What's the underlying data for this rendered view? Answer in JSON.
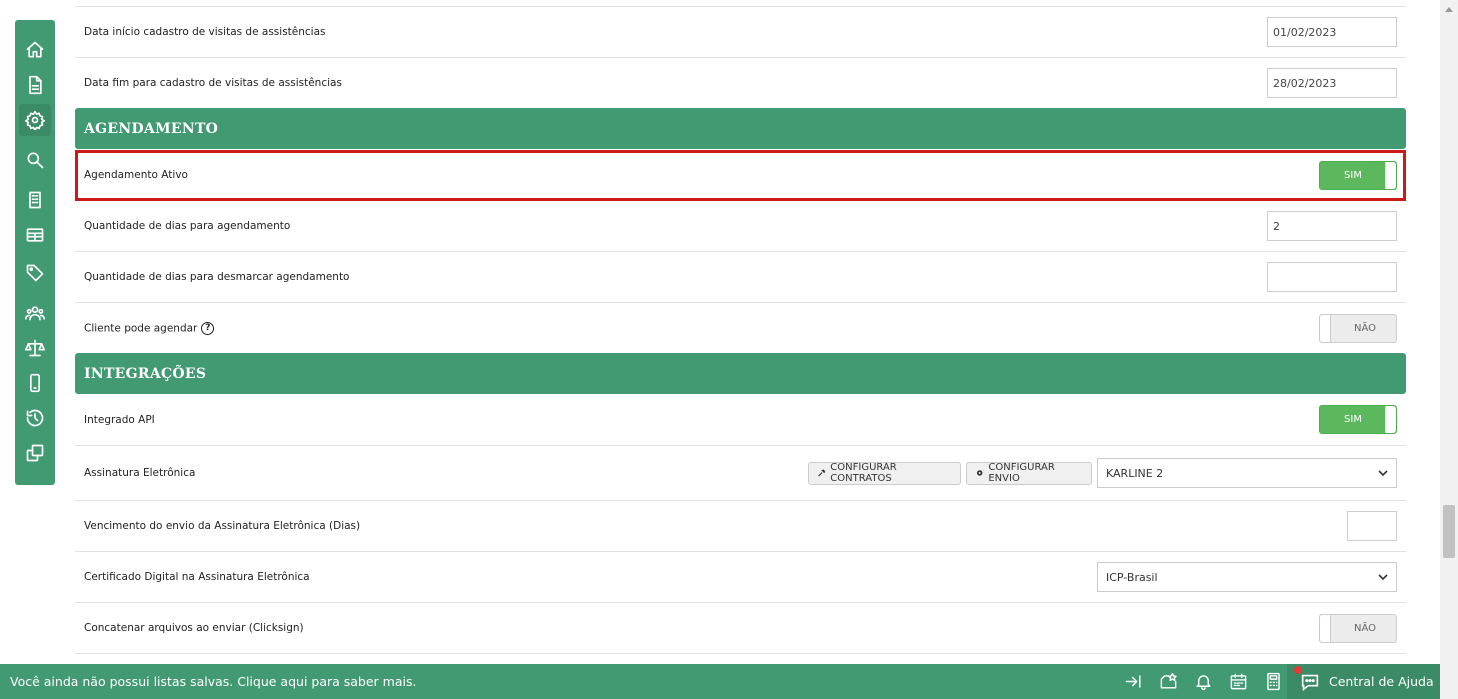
{
  "sidebar": {
    "icons": [
      "home-icon",
      "document-icon",
      "gear-icon",
      "search-icon",
      "building-icon",
      "table-icon",
      "tag-icon",
      "users-icon",
      "scale-icon",
      "mobile-icon",
      "history-icon",
      "copy-icon"
    ]
  },
  "rows": {
    "data_inicio_label": "Data início cadastro de visitas de assistências",
    "data_inicio_value": "01/02/2023",
    "data_fim_label": "Data fim para cadastro de visitas de assistências",
    "data_fim_value": "28/02/2023",
    "agendamento_header": "AGENDAMENTO",
    "agendamento_ativo_label": "Agendamento Ativo",
    "agendamento_ativo_toggle": "SIM",
    "qtd_dias_agendamento_label": "Quantidade de dias para agendamento",
    "qtd_dias_agendamento_value": "2",
    "qtd_dias_desmarcar_label": "Quantidade de dias para desmarcar agendamento",
    "qtd_dias_desmarcar_value": "",
    "cliente_pode_agendar_label": "Cliente pode agendar",
    "cliente_pode_agendar_help": "?",
    "cliente_pode_agendar_toggle": "NÃO",
    "integracoes_header": "INTEGRAÇÕES",
    "integrado_api_label": "Integrado API",
    "integrado_api_toggle": "SIM",
    "assinatura_label": "Assinatura Eletrônica",
    "configurar_contratos": "CONFIGURAR CONTRATOS",
    "configurar_envio": "CONFIGURAR ENVIO",
    "assinatura_select": "KARLINE 2",
    "vencimento_label": "Vencimento do envio da Assinatura Eletrônica (Dias)",
    "vencimento_value": "",
    "certificado_label": "Certificado Digital na Assinatura Eletrônica",
    "certificado_select": "ICP-Brasil",
    "concatenar_label": "Concatenar arquivos ao enviar (Clicksign)",
    "concatenar_toggle": "NÃO"
  },
  "footer": {
    "message": "Você ainda não possui listas salvas. Clique aqui para saber mais.",
    "help_center": "Central de Ajuda",
    "icons": [
      "collapse-icon",
      "list-star-icon",
      "bell-icon",
      "calendar-icon",
      "calculator-icon"
    ]
  },
  "colors": {
    "brand_green": "#429a73",
    "toggle_on": "#5cb85c",
    "highlight_red": "#cc1a1a"
  }
}
